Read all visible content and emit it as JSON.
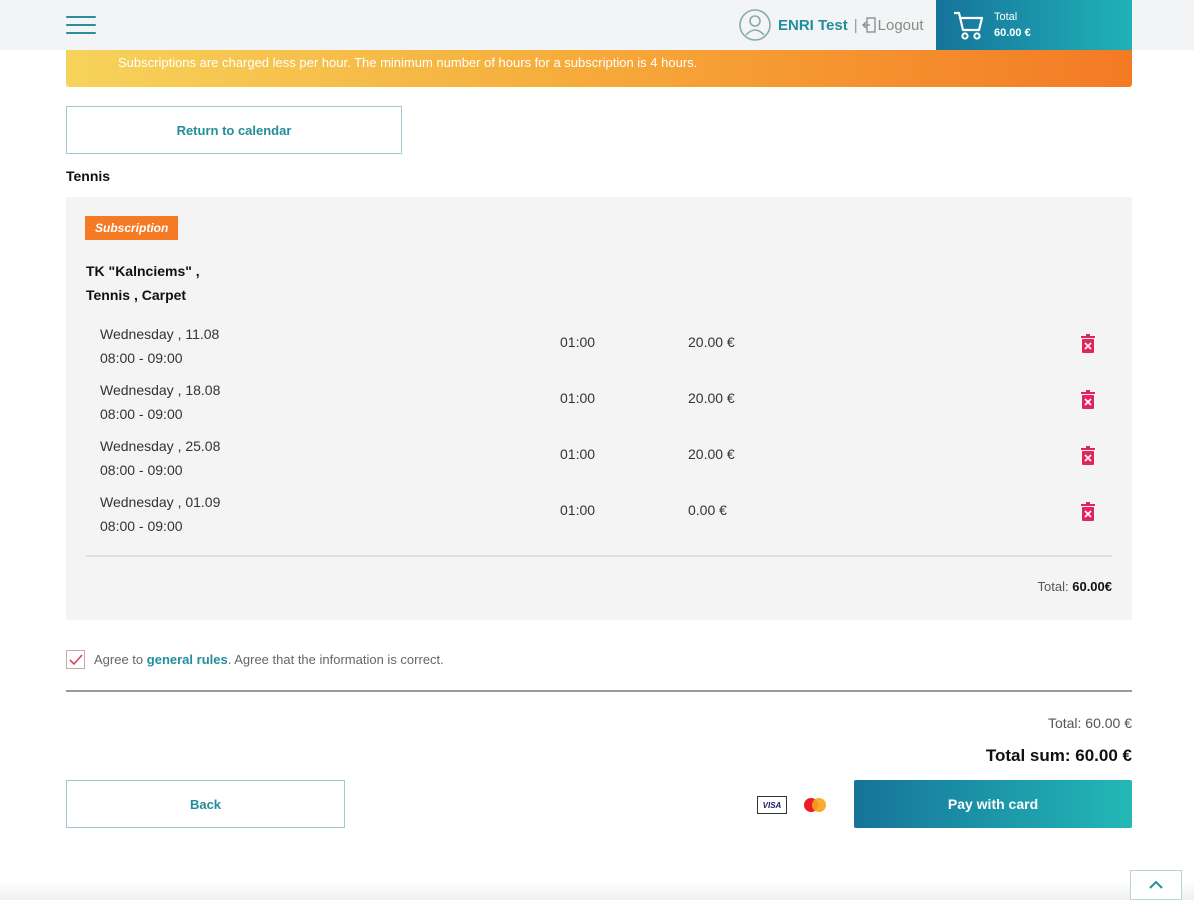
{
  "header": {
    "user_name": "ENRI Test",
    "separator": "|",
    "logout_label": "Logout",
    "cart_label": "Total",
    "cart_amount": "60.00 €"
  },
  "banner": {
    "text": "Subscriptions are charged less per hour. The minimum number of hours for a subscription is 4 hours."
  },
  "return_label": "Return to calendar",
  "sport": "Tennis",
  "booking": {
    "badge": "Subscription",
    "venue_line1": "TK \"Kalnciems\" ,",
    "venue_line2": "Tennis , Carpet",
    "rows": [
      {
        "date": "Wednesday , 11.08",
        "time": "08:00 - 09:00",
        "duration": "01:00",
        "price": "20.00 €"
      },
      {
        "date": "Wednesday , 18.08",
        "time": "08:00 - 09:00",
        "duration": "01:00",
        "price": "20.00 €"
      },
      {
        "date": "Wednesday , 25.08",
        "time": "08:00 - 09:00",
        "duration": "01:00",
        "price": "20.00 €"
      },
      {
        "date": "Wednesday , 01.09",
        "time": "08:00 - 09:00",
        "duration": "01:00",
        "price": "0.00 €"
      }
    ],
    "total_label": "Total:",
    "total_value": "60.00€"
  },
  "agreement": {
    "prefix": "Agree to",
    "link": "general rules",
    "suffix": ". Agree that the information is correct.",
    "checked": true
  },
  "summary": {
    "total": "Total: 60.00 €",
    "total_sum": "Total sum: 60.00 €"
  },
  "back_label": "Back",
  "visa_label": "VISA",
  "pay_label": "Pay with card",
  "colors": {
    "accent": "#238e9b",
    "badge": "#f47a24",
    "trash": "#e0245e"
  }
}
